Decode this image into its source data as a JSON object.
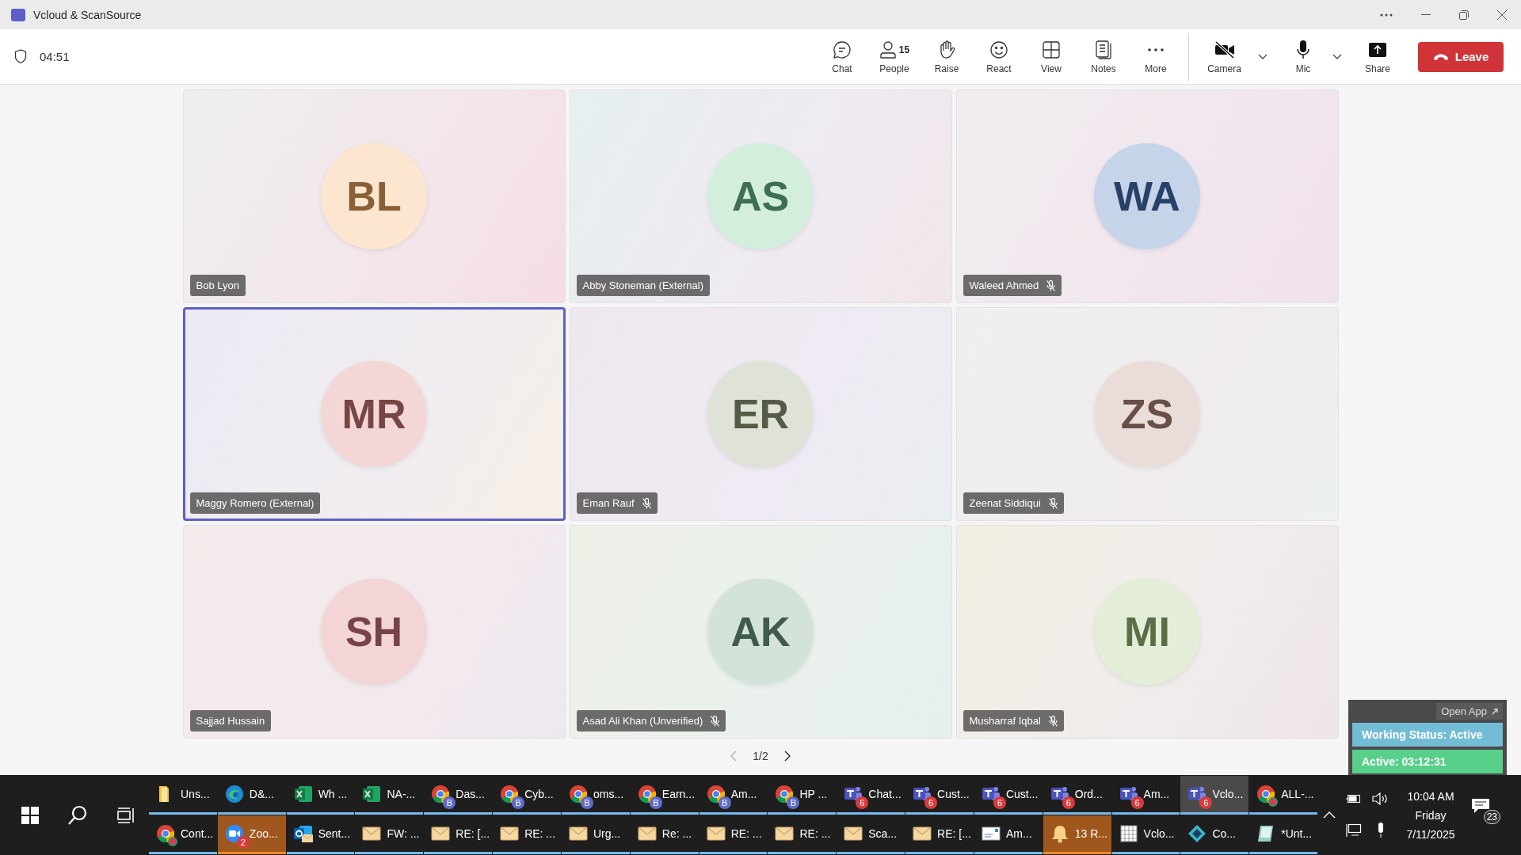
{
  "window": {
    "title": "Vcloud & ScanSource"
  },
  "meeting_bar": {
    "timer": "04:51",
    "controls": [
      {
        "kind": "chat",
        "label": "Chat"
      },
      {
        "kind": "people",
        "label": "People",
        "count": "15"
      },
      {
        "kind": "raise",
        "label": "Raise"
      },
      {
        "kind": "react",
        "label": "React"
      },
      {
        "kind": "view",
        "label": "View"
      },
      {
        "kind": "notes",
        "label": "Notes"
      },
      {
        "kind": "more",
        "label": "More"
      },
      {
        "kind": "camera",
        "label": "Camera",
        "on": false,
        "dropdown": true
      },
      {
        "kind": "mic",
        "label": "Mic",
        "on": true,
        "dropdown": true
      },
      {
        "kind": "share",
        "label": "Share"
      }
    ],
    "leave_button": "Leave"
  },
  "participants": [
    {
      "initials": "BL",
      "name": "Bob Lyon",
      "muted": false,
      "selected": false,
      "color": "#fde6cf"
    },
    {
      "initials": "AS",
      "name": "Abby Stoneman (External)",
      "muted": false,
      "selected": false,
      "color": "#d3eedd"
    },
    {
      "initials": "WA",
      "name": "Waleed Ahmed",
      "muted": true,
      "selected": false,
      "color": "#c6d4ea"
    },
    {
      "initials": "MR",
      "name": "Maggy Romero (External)",
      "muted": false,
      "selected": true,
      "color": "#f3d6d6"
    },
    {
      "initials": "ER",
      "name": "Eman Rauf",
      "muted": true,
      "selected": false,
      "color": "#dfe3d7"
    },
    {
      "initials": "ZS",
      "name": "Zeenat Siddiqui",
      "muted": true,
      "selected": false,
      "color": "#eadcd8"
    },
    {
      "initials": "SH",
      "name": "Sajjad Hussain",
      "muted": false,
      "selected": false,
      "color": "#f3d5d8"
    },
    {
      "initials": "AK",
      "name": "Asad Ali Khan (Unverified)",
      "muted": true,
      "selected": false,
      "color": "#d3e3d9"
    },
    {
      "initials": "MI",
      "name": "Musharraf Iqbal",
      "muted": true,
      "selected": false,
      "color": "#e4edd7"
    }
  ],
  "pager": {
    "label": "1/2",
    "previous_disabled": true
  },
  "status_widget": {
    "open_app": "Open App",
    "working_status": "Working Status: Active",
    "active_time": "Active: 03:12:31"
  },
  "taskbar": {
    "rows": [
      [
        {
          "kind": "folder",
          "label": "Uns...",
          "active": false,
          "flashing": false
        },
        {
          "kind": "edge",
          "label": "D&...",
          "active": false,
          "flashing": false
        },
        {
          "kind": "excel",
          "label": "Wh ...",
          "active": false,
          "flashing": false
        },
        {
          "kind": "excel",
          "label": "NA-...",
          "active": false,
          "flashing": false
        },
        {
          "kind": "chrome",
          "label": "Das...",
          "badge": "B",
          "active": false,
          "flashing": false
        },
        {
          "kind": "chrome",
          "label": "Cyb...",
          "badge": "B",
          "active": false,
          "flashing": false
        },
        {
          "kind": "chrome",
          "label": "oms...",
          "badge": "B",
          "active": false,
          "flashing": false
        },
        {
          "kind": "chrome",
          "label": "Earn...",
          "badge": "B",
          "active": false,
          "flashing": false
        },
        {
          "kind": "chrome",
          "label": "Am...",
          "badge": "B",
          "active": false,
          "flashing": false
        },
        {
          "kind": "chrome",
          "label": "HP ...",
          "badge": "B",
          "active": false,
          "flashing": false
        },
        {
          "kind": "teams",
          "label": "Chat...",
          "badge": "6",
          "active": false,
          "flashing": false
        },
        {
          "kind": "teams",
          "label": "Cust...",
          "badge": "6",
          "active": false,
          "flashing": false
        },
        {
          "kind": "teams",
          "label": "Cust...",
          "badge": "6",
          "active": false,
          "flashing": false
        },
        {
          "kind": "teams",
          "label": "Ord...",
          "badge": "6",
          "active": false,
          "flashing": false
        },
        {
          "kind": "teams",
          "label": "Am...",
          "badge": "6",
          "active": false,
          "flashing": false
        },
        {
          "kind": "teams",
          "label": "Vclo...",
          "badge": "6",
          "active": true,
          "flashing": false
        },
        {
          "kind": "chrome-dot",
          "label": "ALL-...",
          "active": false,
          "flashing": false
        }
      ],
      [
        {
          "kind": "chrome-dot",
          "label": "Cont...",
          "active": false,
          "flashing": false
        },
        {
          "kind": "zoom",
          "label": "Zoo...",
          "badge": "2",
          "active": false,
          "flashing": true
        },
        {
          "kind": "outlook",
          "label": "Sent...",
          "active": false,
          "flashing": false
        },
        {
          "kind": "mail",
          "label": "FW: ...",
          "active": false,
          "flashing": false
        },
        {
          "kind": "mail",
          "label": "RE: [...",
          "active": false,
          "flashing": false
        },
        {
          "kind": "mail",
          "label": "RE: ...",
          "active": false,
          "flashing": false
        },
        {
          "kind": "mail",
          "label": "Urg...",
          "active": false,
          "flashing": false
        },
        {
          "kind": "mail",
          "label": "Re: ...",
          "active": false,
          "flashing": false
        },
        {
          "kind": "mail",
          "label": "RE: ...",
          "active": false,
          "flashing": false
        },
        {
          "kind": "mail",
          "label": "RE: ...",
          "active": false,
          "flashing": false
        },
        {
          "kind": "mail",
          "label": "Sca...",
          "active": false,
          "flashing": false
        },
        {
          "kind": "mail",
          "label": "RE: [...",
          "active": false,
          "flashing": false
        },
        {
          "kind": "letter",
          "label": "Am...",
          "active": false,
          "flashing": false
        },
        {
          "kind": "bell",
          "label": "13 R...",
          "active": false,
          "flashing": true
        },
        {
          "kind": "calendar",
          "label": "Vclo...",
          "active": false,
          "flashing": false
        },
        {
          "kind": "diamond",
          "label": "Co...",
          "active": false,
          "flashing": false
        },
        {
          "kind": "paint",
          "label": "*Unt...",
          "active": false,
          "flashing": false
        }
      ]
    ],
    "clock": {
      "time": "10:04 AM",
      "day": "Friday",
      "date": "7/11/2025"
    },
    "notifications": "23"
  }
}
